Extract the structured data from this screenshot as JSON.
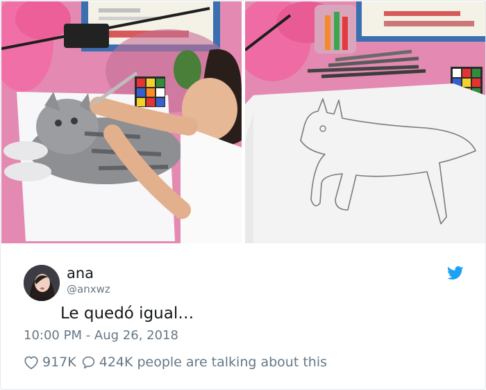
{
  "tweet": {
    "display_name": "ana",
    "handle": "@anxwz",
    "text": "Le quedó igual…",
    "timestamp": "10:00 PM - Aug 26, 2018",
    "likes": "917K",
    "replies": "424K",
    "talking_text": "people are talking about this"
  },
  "icons": {
    "brand": "twitter-bird-icon",
    "like": "heart-icon",
    "reply": "speech-bubble-icon"
  },
  "colors": {
    "brand_blue": "#1da1f2",
    "secondary_text": "#657786",
    "primary_text": "#14171a",
    "desk_pink": "#e98bb4"
  }
}
